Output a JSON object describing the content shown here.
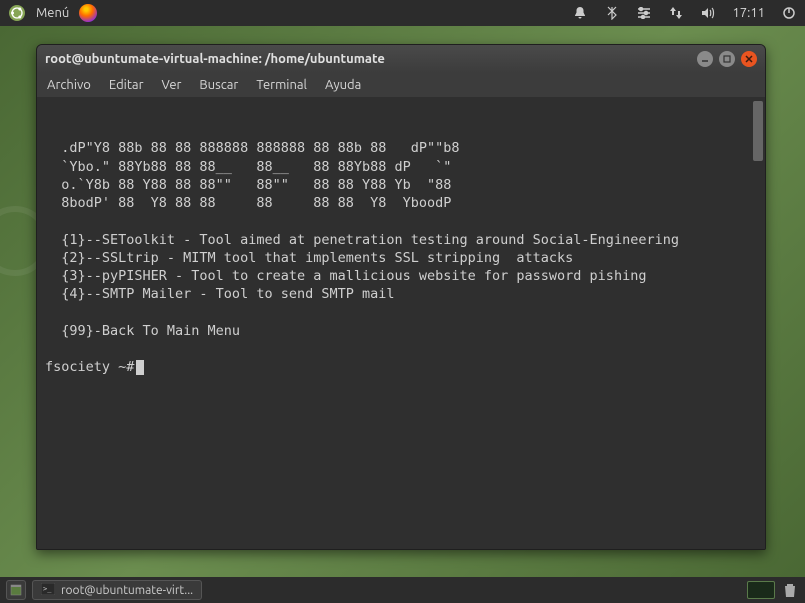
{
  "top_panel": {
    "menu_label": "Menú",
    "time": "17:11"
  },
  "terminal": {
    "title": "root@ubuntumate-virtual-machine: /home/ubuntumate",
    "menu": {
      "archivo": "Archivo",
      "editar": "Editar",
      "ver": "Ver",
      "buscar": "Buscar",
      "terminal": "Terminal",
      "ayuda": "Ayuda"
    },
    "ascii_art": "  .dP\"Y8 88b 88 88 888888 888888 88 88b 88   dP\"\"b8\n  `Ybo.\" 88Yb88 88 88__   88__   88 88Yb88 dP   `\"\n  o.`Y8b 88 Y88 88 88\"\"   88\"\"   88 88 Y88 Yb  \"88\n  8bodP' 88  Y8 88 88     88     88 88  Y8  YboodP",
    "menu_items": {
      "i1": "  {1}--SEToolkit - Tool aimed at penetration testing around Social-Engineering",
      "i2": "  {2}--SSLtrip - MITM tool that implements SSL stripping  attacks",
      "i3": "  {3}--pyPISHER - Tool to create a mallicious website for password pishing",
      "i4": "  {4}--SMTP Mailer - Tool to send SMTP mail",
      "i99": "  {99}-Back To Main Menu"
    },
    "prompt": "fsociety ~#"
  },
  "taskbar": {
    "task_label": "root@ubuntumate-virt..."
  }
}
